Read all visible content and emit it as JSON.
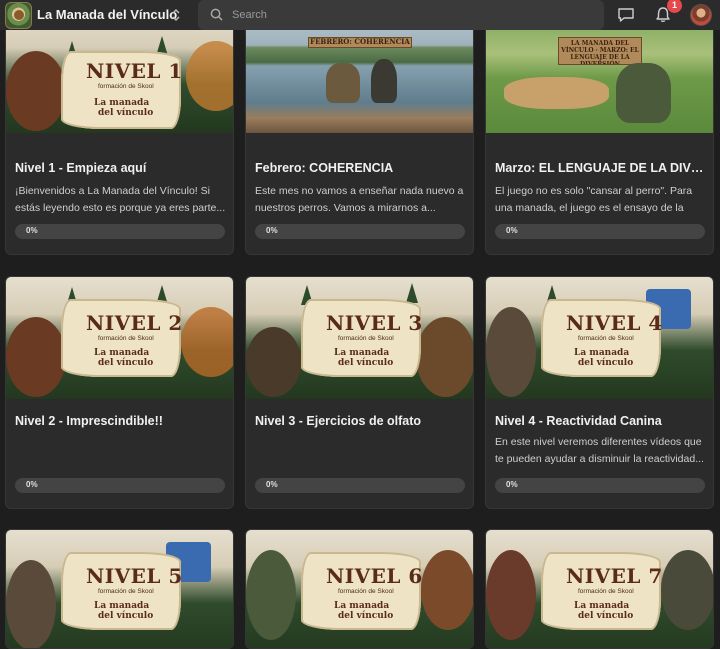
{
  "app": {
    "group_name": "La Manada del Vínculo",
    "search_placeholder": "Search",
    "notification_count": "1"
  },
  "courses": [
    {
      "title": "Nivel 1 - Empieza aquí",
      "description": "¡Bienvenidos a La Manada del Vínculo! Si estás leyendo esto es porque ya eres parte...",
      "progress": "0%",
      "thumb": {
        "nivel": "NIVEL 1",
        "sub": "formación de Skool",
        "manada_1": "La manada",
        "manada_2": "del vínculo"
      }
    },
    {
      "title": "Febrero: COHERENCIA",
      "description": "Este mes no vamos a enseñar nada nuevo a nuestros perros. Vamos a mirarnos a...",
      "progress": "0%",
      "thumb": {
        "sign": "FEBRERO: COHERENCIA"
      }
    },
    {
      "title": "Marzo: EL LENGUAJE DE LA DIVE...",
      "description": "El juego no es solo \"cansar al perro\". Para una manada, el juego es el ensayo de la vid...",
      "progress": "0%",
      "thumb": {
        "sign": "LA MANADA DEL VÍNCULO · MARZO: EL LENGUAJE DE LA DIVERSIÓN"
      }
    },
    {
      "title": "Nivel 2 - Imprescindible!!",
      "description": "",
      "progress": "0%",
      "thumb": {
        "nivel": "NIVEL 2",
        "sub": "formación de Skool",
        "manada_1": "La manada",
        "manada_2": "del vínculo"
      }
    },
    {
      "title": "Nivel 3 - Ejercicios de olfato",
      "description": "",
      "progress": "0%",
      "thumb": {
        "nivel": "NIVEL 3",
        "sub": "formación de Skool",
        "manada_1": "La manada",
        "manada_2": "del vínculo"
      }
    },
    {
      "title": "Nivel 4 - Reactividad Canina",
      "description": "En este nivel veremos diferentes vídeos que te pueden ayudar a disminuir la reactividad...",
      "progress": "0%",
      "thumb": {
        "nivel": "NIVEL 4",
        "sub": "formación de Skool",
        "manada_1": "La manada",
        "manada_2": "del vínculo"
      }
    },
    {
      "title": "",
      "description": "",
      "progress": "",
      "thumb": {
        "nivel": "NIVEL 5",
        "sub": "formación de Skool",
        "manada_1": "La manada",
        "manada_2": "del vínculo"
      }
    },
    {
      "title": "",
      "description": "",
      "progress": "",
      "thumb": {
        "nivel": "NIVEL 6",
        "sub": "formación de Skool",
        "manada_1": "La manada",
        "manada_2": "del vínculo"
      }
    },
    {
      "title": "",
      "description": "",
      "progress": "",
      "thumb": {
        "nivel": "NIVEL 7",
        "sub": "formación de Skool",
        "manada_1": "La manada",
        "manada_2": "del vínculo"
      }
    }
  ]
}
